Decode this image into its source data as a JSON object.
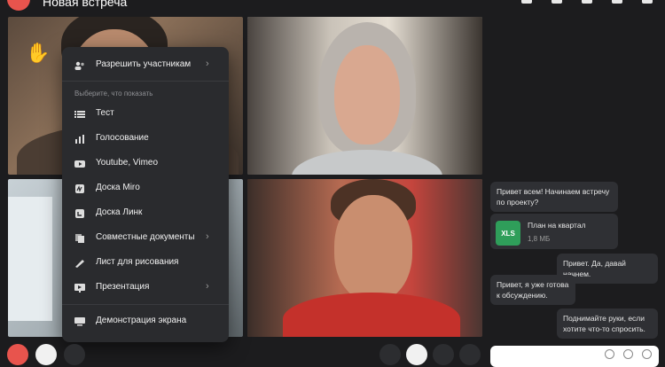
{
  "header": {
    "title": "Новая встреча"
  },
  "menu": {
    "allow_participants": "Разрешить участникам",
    "hint": "Выберите, что показать",
    "items": [
      {
        "label": "Тест",
        "icon": "list-icon"
      },
      {
        "label": "Голосование",
        "icon": "bar-chart-icon"
      },
      {
        "label": "Youtube, Vimeo",
        "icon": "youtube-icon"
      },
      {
        "label": "Доска Miro",
        "icon": "miro-icon"
      },
      {
        "label": "Доска Линк",
        "icon": "link-board-icon"
      },
      {
        "label": "Совместные документы",
        "icon": "documents-icon"
      },
      {
        "label": "Лист для рисования",
        "icon": "pen-icon"
      },
      {
        "label": "Презентация",
        "icon": "presentation-icon"
      }
    ],
    "screen_share": "Демонстрация экрана"
  },
  "chat": {
    "messages": [
      {
        "text": "Привет всем! Начинаем встречу по проекту?",
        "side": "left"
      },
      {
        "text": "Привет. Да, давай начнем.",
        "side": "right"
      },
      {
        "text": "Привет, я уже готова к обсуждению.",
        "side": "left"
      },
      {
        "text": "Поднимайте руки, если хотите что-то спросить.",
        "side": "right"
      }
    ],
    "file": {
      "badge": "XLS",
      "name": "План на квартал",
      "size": "1,8 МБ"
    }
  },
  "colors": {
    "accent_red": "#e8544d",
    "xls_green": "#2f9e5a",
    "menu_bg": "#2a2b2e",
    "bubble_bg": "#2f3034"
  }
}
